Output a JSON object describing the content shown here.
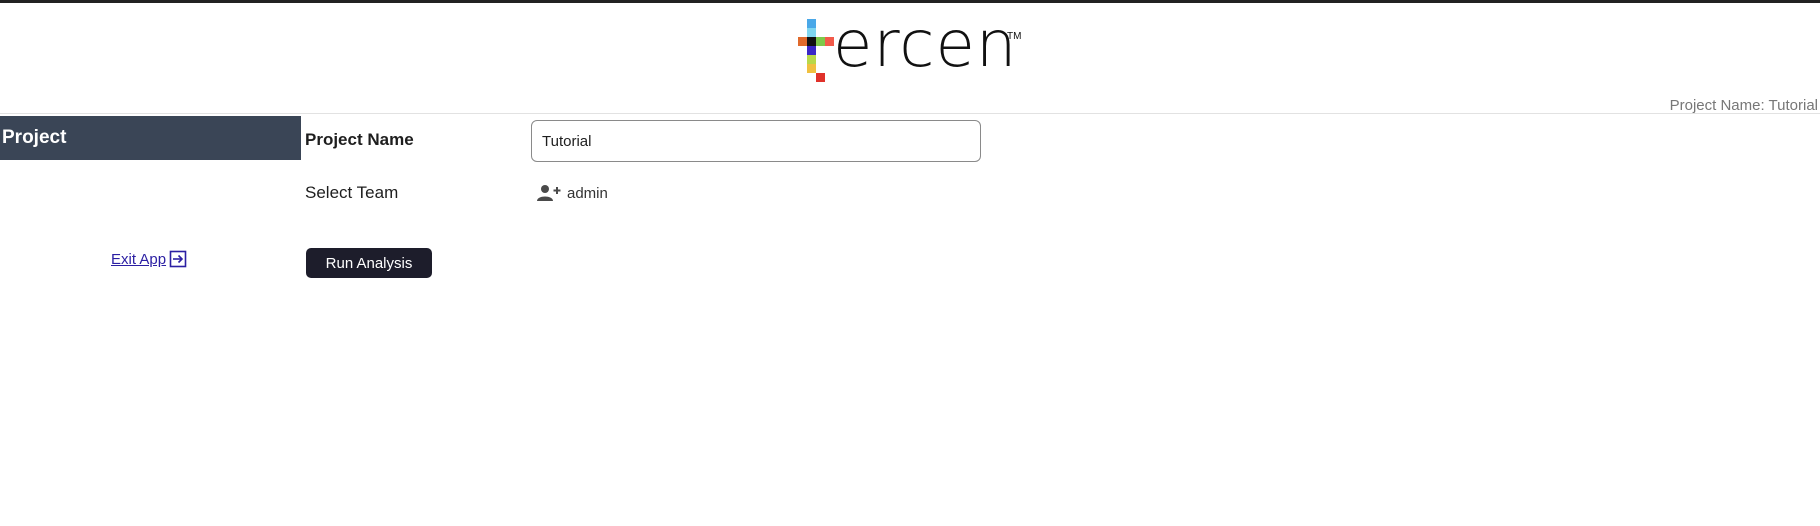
{
  "header": {
    "logo_text": "ercen",
    "trademark": "TM",
    "project_name_label": "Project Name: Tutorial",
    "logo_colors": [
      "#4aa8e8",
      "#7fd6f0",
      "#e06a2c",
      "#111111",
      "#7ec94a",
      "#f25a4a",
      "#3a27c8",
      "#b8d84a",
      "#f0c040",
      "#e0312a"
    ]
  },
  "sidebar": {
    "title": "Project",
    "exit_label": "Exit App"
  },
  "form": {
    "project_name_label": "Project Name",
    "project_name_value": "Tutorial",
    "select_team_label": "Select Team",
    "team_value": "admin",
    "run_button_label": "Run Analysis"
  }
}
